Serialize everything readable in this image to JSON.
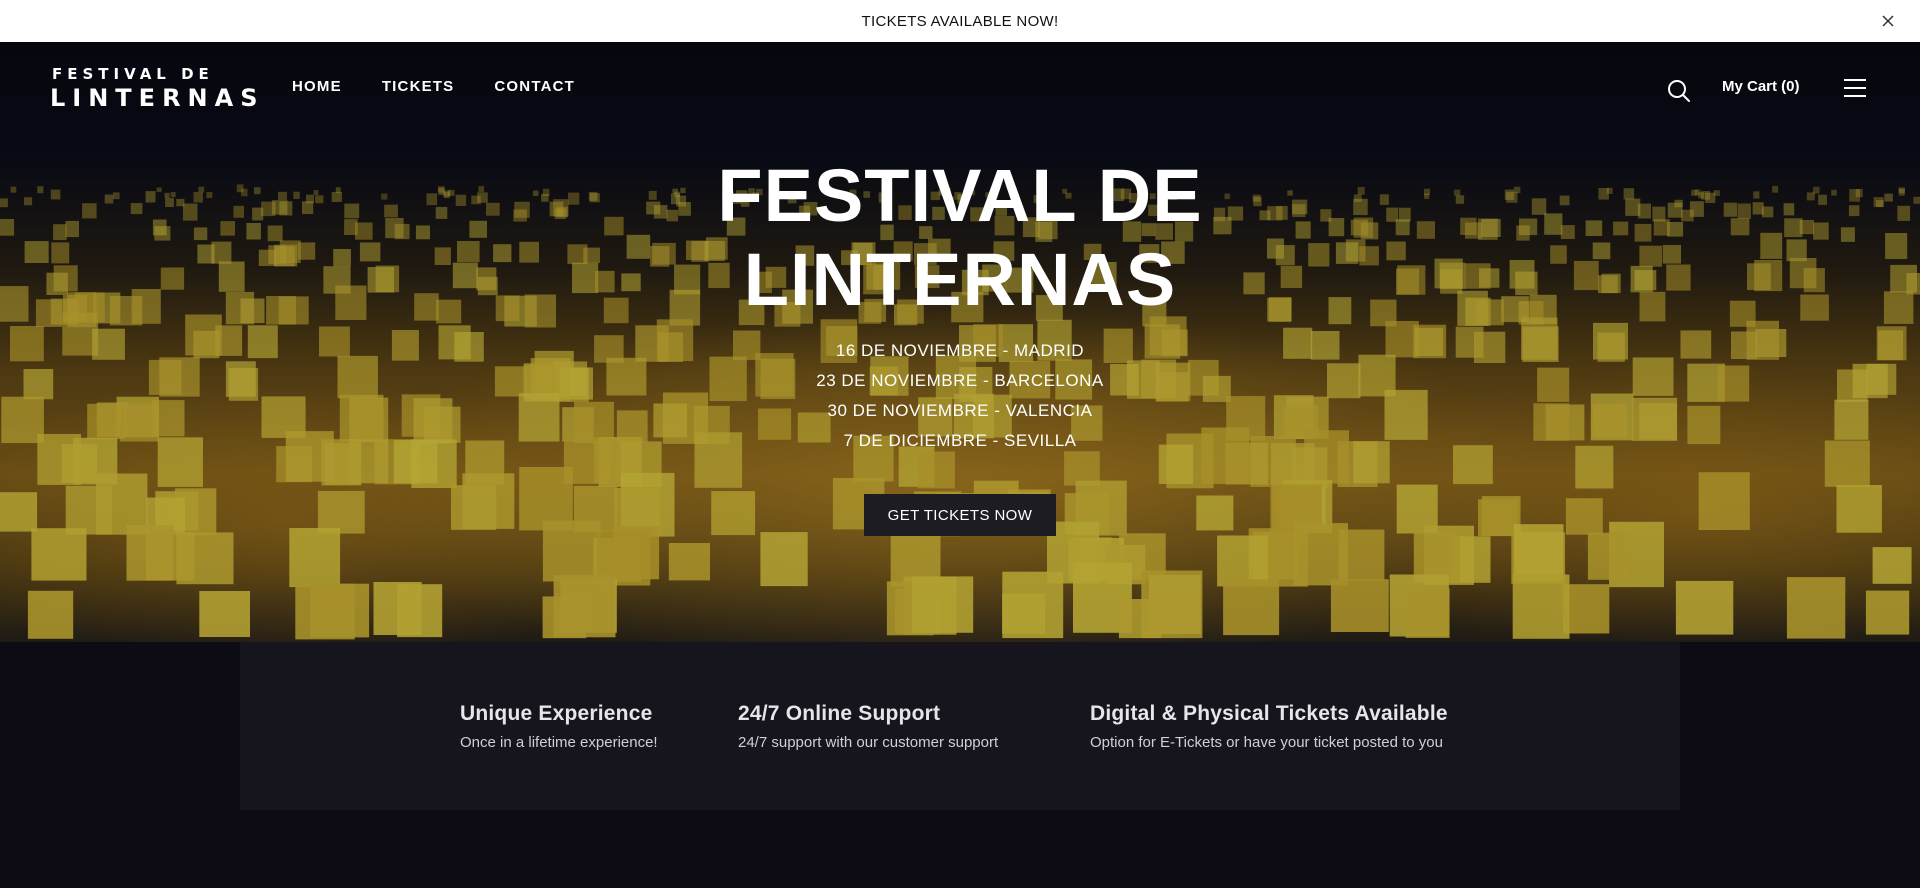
{
  "announcement": {
    "text": "TICKETS AVAILABLE NOW!"
  },
  "logo": {
    "line1": "FESTIVAL DE",
    "line2": "LINTERNAS"
  },
  "nav": {
    "items": [
      "HOME",
      "TICKETS",
      "CONTACT"
    ]
  },
  "header": {
    "cart_label": "My Cart (0)"
  },
  "hero": {
    "title_line1": "FESTIVAL DE",
    "title_line2": "LINTERNAS",
    "dates": [
      "16 DE NOVIEMBRE - MADRID",
      "23 DE NOVIEMBRE - BARCELONA",
      "30 DE NOVIEMBRE - VALENCIA",
      "7 DE DICIEMBRE - SEVILLA"
    ],
    "cta_label": "GET TICKETS NOW"
  },
  "features": [
    {
      "title": "Unique Experience",
      "text": "Once in a lifetime experience!"
    },
    {
      "title": "24/7 Online Support",
      "text": "24/7 support with our customer support"
    },
    {
      "title": "Digital & Physical Tickets Available",
      "text": "Option for E-Tickets or have your ticket posted to you"
    }
  ],
  "icons": {
    "close": "close-icon",
    "search": "search-icon",
    "menu": "hamburger-menu-icon",
    "logo": "flame-icon"
  },
  "colors": {
    "page_bg": "#0d0c14",
    "features_bg": "#16151d",
    "cta_bg": "#1c1c22",
    "lantern_glow": "#e6a828"
  }
}
